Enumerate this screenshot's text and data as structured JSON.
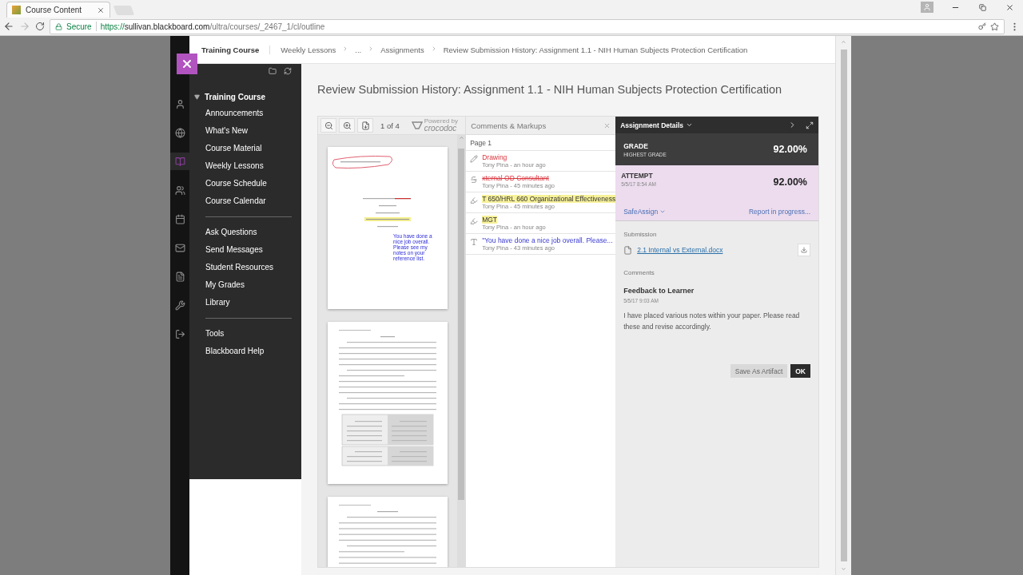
{
  "browser": {
    "tab_title": "Course Content",
    "secure_label": "Secure",
    "url": {
      "scheme": "https://",
      "host": "sullivan.blackboard.com",
      "path": "/ultra/courses/_2467_1/cl/outline"
    }
  },
  "breadcrumbs": [
    {
      "label": "Training Course",
      "kind": "course"
    },
    {
      "label": "Weekly Lessons",
      "kind": "link"
    },
    {
      "label": "...",
      "kind": "link"
    },
    {
      "label": "Assignments",
      "kind": "link"
    },
    {
      "label": "Review Submission History: Assignment 1.1 - NIH Human Subjects Protection Certification",
      "kind": "current"
    }
  ],
  "rail": [
    {
      "kind": "profile",
      "selected": false
    },
    {
      "kind": "globe",
      "selected": false
    },
    {
      "kind": "courses",
      "selected": true
    },
    {
      "kind": "groups",
      "selected": false
    },
    {
      "kind": "calendar",
      "selected": false
    },
    {
      "kind": "messages",
      "selected": false
    },
    {
      "kind": "grades",
      "selected": false
    },
    {
      "kind": "tools",
      "selected": false
    },
    {
      "kind": "signout",
      "selected": false
    }
  ],
  "nav": {
    "header": "Training Course",
    "expanded": true,
    "groups": [
      [
        "Announcements",
        "What's New",
        "Course Material",
        "Weekly Lessons",
        "Course Schedule",
        "Course Calendar"
      ],
      [
        "Ask Questions",
        "Send Messages",
        "Student Resources",
        "My Grades",
        "Library"
      ],
      [
        "Tools",
        "Blackboard Help"
      ]
    ]
  },
  "page_title": "Review Submission History: Assignment 1.1 - NIH Human Subjects Protection Certification",
  "viewer": {
    "page_indicator": "1 of 4",
    "powered_by": "Powered by",
    "brand": "crocodoc",
    "annotation": "You have done a nice job overall. Please see my notes on your reference list."
  },
  "comments": {
    "title": "Comments & Markups",
    "page_label": "Page 1",
    "items": [
      {
        "kind": "drawing",
        "text": "Drawing",
        "meta": "Tony Pina - an hour ago"
      },
      {
        "kind": "strikeout",
        "text": "xternal OD Consultant",
        "meta": "Tony Pina - 45 minutes ago"
      },
      {
        "kind": "highlight",
        "text": "T 650/HRL 660 Organizational Effectiveness",
        "meta": "Tony Pina - 45 minutes ago"
      },
      {
        "kind": "highlight",
        "text": "MGT",
        "meta": "Tony Pina - an hour ago"
      },
      {
        "kind": "textbox",
        "text": "\"You have done a nice job overall.  Please...",
        "meta": "Tony Pina - 43 minutes ago"
      }
    ]
  },
  "details": {
    "title": "Assignment Details",
    "grade": {
      "label": "GRADE",
      "sublabel": "HIGHEST GRADE",
      "value": "92.00%"
    },
    "attempt": {
      "label": "ATTEMPT",
      "date": "5/5/17 8:54 AM",
      "value": "92.00%",
      "safeassign": "SafeAssign",
      "report": "Report in progress..."
    },
    "submission_label": "Submission",
    "file": "2.1 Internal vs External.docx",
    "comments_label": "Comments",
    "feedback": {
      "title": "Feedback to Learner",
      "date": "5/5/17 9:03 AM",
      "body": "I have placed various notes within your paper. Please read these and revise accordingly."
    },
    "buttons": [
      {
        "label": "Save As Artifact",
        "kind": "secondary"
      },
      {
        "label": "OK",
        "kind": "primary"
      }
    ]
  }
}
